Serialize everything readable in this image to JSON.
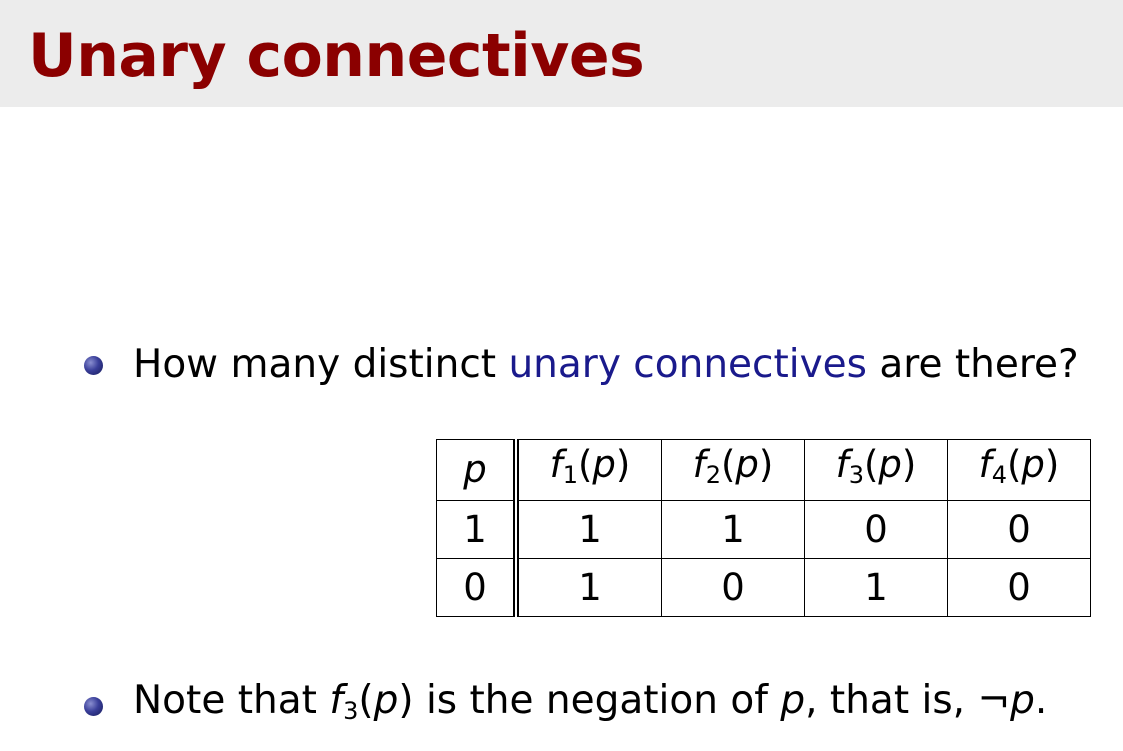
{
  "slide": {
    "title": "Unary connectives"
  },
  "bullets": {
    "question": {
      "before": "How many distinct ",
      "highlight": "unary connectives",
      "after": " are there?"
    },
    "note": {
      "before": "Note that ",
      "fn_name": "f",
      "fn_sub": "3",
      "fn_arg": "p",
      "middle": " is the negation of ",
      "var": "p",
      "after": ", that is, ",
      "neg_symbol": "¬",
      "neg_var": "p",
      "end": "."
    }
  },
  "truth_table": {
    "var_header": "p",
    "columns": [
      {
        "name": "f",
        "sub": "1",
        "arg": "p"
      },
      {
        "name": "f",
        "sub": "2",
        "arg": "p"
      },
      {
        "name": "f",
        "sub": "3",
        "arg": "p"
      },
      {
        "name": "f",
        "sub": "4",
        "arg": "p"
      }
    ],
    "rows": [
      {
        "p": "1",
        "values": [
          "1",
          "1",
          "0",
          "0"
        ]
      },
      {
        "p": "0",
        "values": [
          "1",
          "0",
          "1",
          "0"
        ]
      }
    ]
  },
  "colors": {
    "title": "#8b0000",
    "title_bar": "#ececec",
    "highlight": "#1a1a8c",
    "bullet": "#3a3f9a"
  }
}
